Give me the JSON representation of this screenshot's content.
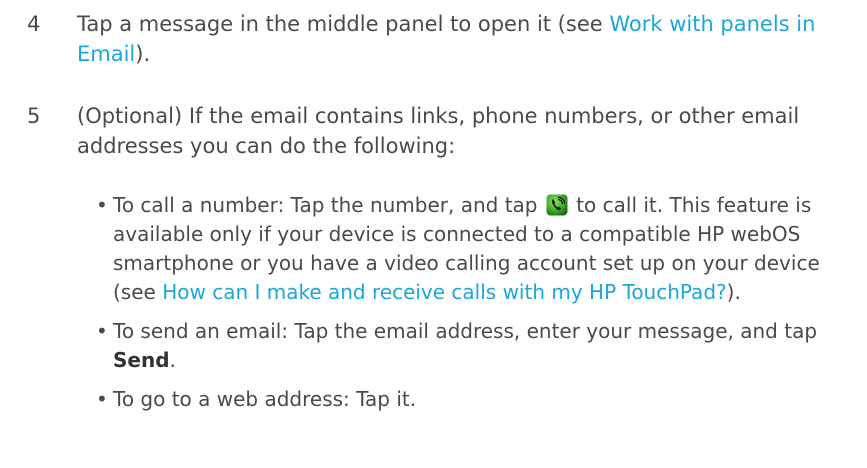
{
  "step4": {
    "number": "4",
    "text_before": "Tap a message in the middle panel to open it (see ",
    "link": "Work with panels in Email",
    "text_after": ")."
  },
  "step5": {
    "number": "5",
    "text": "(Optional) If the email contains links, phone numbers, or other email addresses you can do the following:"
  },
  "bullets": {
    "bullet_char": "•",
    "call": {
      "text_before_icon": "To call a number: Tap the number, and tap ",
      "icon": "phone-call-icon",
      "text_after_icon": " to call it. This feature is available only if your device is connected to a compatible HP webOS smartphone or you have a video calling account set up on your device (see ",
      "link": "How can I make and receive calls with my HP TouchPad?",
      "text_end": ")."
    },
    "email": {
      "text_before": "To send an email: Tap the email address, enter your message, and tap ",
      "bold": "Send",
      "text_after": "."
    },
    "web": {
      "text": "To go to a web address: Tap it."
    }
  },
  "colors": {
    "body_text": "#4a4a4a",
    "link": "#1ba6dc",
    "icon_green": "#3fae29"
  }
}
